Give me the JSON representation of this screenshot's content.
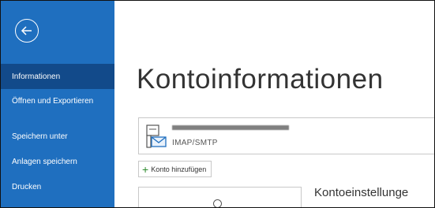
{
  "colors": {
    "sidebar_bg": "#1f6fbf",
    "sidebar_active": "#124a8a",
    "accent_plus": "#2e8b2e"
  },
  "back": {
    "icon": "arrow-left-circle-icon"
  },
  "nav": {
    "items": [
      {
        "label": "Informationen",
        "active": true
      },
      {
        "label": "Öffnen und Exportieren",
        "active": false
      },
      {
        "label": "Speichern unter",
        "active": false
      },
      {
        "label": "Anlagen speichern",
        "active": false
      },
      {
        "label": "Drucken",
        "active": false
      }
    ]
  },
  "main": {
    "title": "Kontoinformationen",
    "account": {
      "type": "IMAP/SMTP",
      "icon": "mail-account-icon"
    },
    "add_account_label": "Konto hinzufügen",
    "settings_heading": "Kontoeinstellunge"
  }
}
